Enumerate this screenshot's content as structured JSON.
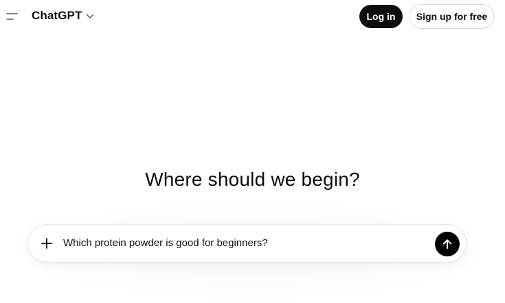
{
  "header": {
    "brand": "ChatGPT",
    "login_label": "Log in",
    "signup_label": "Sign up for free"
  },
  "main": {
    "headline": "Where should we begin?"
  },
  "composer": {
    "prompt_value": "Which protein powder is good for beginners?"
  },
  "icons": {
    "menu": "sidebar-toggle-icon",
    "brand_dropdown": "chevron-down-icon",
    "attach": "plus-icon",
    "send": "arrow-up-icon"
  },
  "colors": {
    "primary_button": "#0d0d0d",
    "send_button": "#000000",
    "text": "#0d0d0d",
    "border": "#d9d9d9"
  }
}
